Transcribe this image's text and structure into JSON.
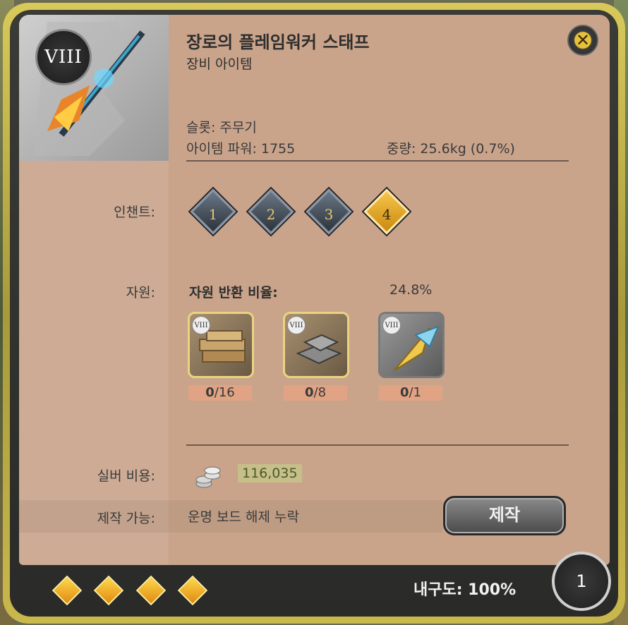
{
  "item": {
    "tier": "VIII",
    "name": "장로의 플레임워커 스태프",
    "category": "장비 아이템",
    "slot_text": "슬롯: 주무기",
    "power_text": "아이템 파워: 1755",
    "weight_text": "중량: 25.6kg (0.7%)"
  },
  "enchant": {
    "label": "인챈트:",
    "levels": [
      {
        "num": "1",
        "active": false
      },
      {
        "num": "2",
        "active": false
      },
      {
        "num": "3",
        "active": false
      },
      {
        "num": "4",
        "active": true
      }
    ]
  },
  "resources": {
    "label": "자원:",
    "heading": "자원 반환 비율:",
    "rate": "24.8%",
    "items": [
      {
        "tier": "VIII",
        "count_have": "0",
        "count_need": "/16",
        "icon": "planks-icon"
      },
      {
        "tier": "VIII",
        "count_have": "0",
        "count_need": "/8",
        "icon": "metal-bar-icon"
      },
      {
        "tier": "VIII",
        "count_have": "0",
        "count_need": "/1",
        "icon": "crystal-artifact-icon"
      }
    ]
  },
  "silver": {
    "label": "실버 비용:",
    "value": "116,035"
  },
  "craft": {
    "label": "제작 가능:",
    "status": "운명 보드 해제 누락",
    "button": "제작"
  },
  "footer": {
    "durability": "내구도: 100%",
    "quantity": "1",
    "quality_diamonds": 4
  },
  "colors": {
    "panel": "#c9a48b",
    "frame_gold": "#d8c95a",
    "silver_bg": "#c6bf8a",
    "count_bg": "#e0a383"
  }
}
